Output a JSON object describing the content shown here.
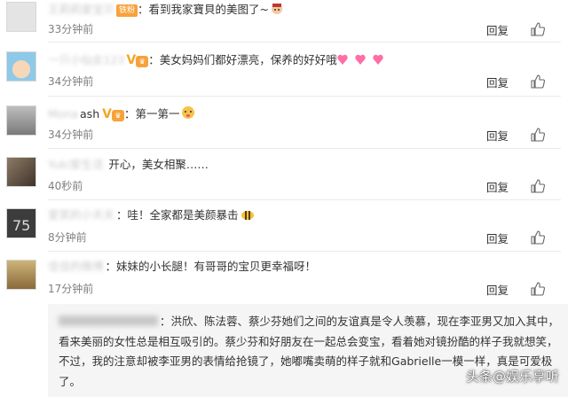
{
  "comments": [
    {
      "text": "：看到我家寶貝的美图了~",
      "time": "33分钟前",
      "badge": "铁粉",
      "avatar_color": "#cfcfcf"
    },
    {
      "text": "：美女妈妈们都好漂亮，保养的好好哦",
      "time": "34分钟前",
      "avatar_color": "#8fc9e8"
    },
    {
      "name_tail": "ash",
      "text": "：第一第一",
      "time": "34分钟前",
      "avatar_color": "#9a9a9a"
    },
    {
      "text": "开心，美女相聚……",
      "time": "40秒前",
      "avatar_color": "#6b5a4a"
    },
    {
      "text": "：哇！全家都是美颜暴击",
      "time": "8分钟前",
      "avatar_color": "#4a4a4a"
    },
    {
      "text": "：妹妹的小长腿！有哥哥的宝贝更幸福呀！",
      "time": "17分钟前",
      "avatar_color": "#b8863f"
    }
  ],
  "actions": {
    "reply_label": "回复"
  },
  "quote": {
    "text": "：洪欣、陈法蓉、蔡少芬她们之间的友谊真是令人羡慕，现在李亚男又加入其中，看来美丽的女性总是相互吸引的。蔡少芬和好朋友在一起总会变宝，看着她对镜扮酷的样子我就想笑，不过，我的注意却被李亚男的表情给抢镜了，她嘟嘴卖萌的样子就和Gabrielle一模一样，真是可爱极了。"
  },
  "watermark": "头条@娱乐享听",
  "colors": {
    "time": "#808080",
    "badge": "#f7a23b",
    "quote_bg": "#f5f5f5"
  }
}
